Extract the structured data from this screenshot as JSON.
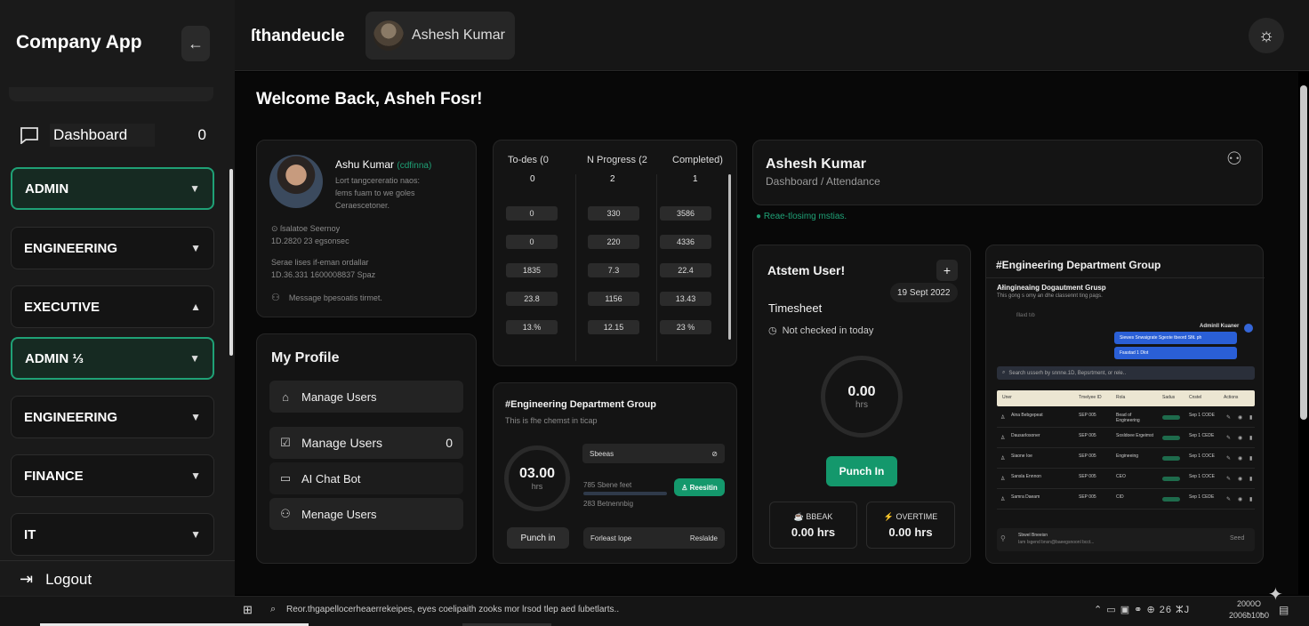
{
  "sidebar": {
    "brand": "Company App",
    "collapse_icon": "←",
    "dashboard": {
      "label": "Dashboard",
      "count": "0"
    },
    "groups": [
      {
        "label": "ADMIN",
        "chevron": "⌄",
        "active": true
      },
      {
        "label": "ENGINEERING",
        "chevron": "⌄",
        "active": false
      },
      {
        "label": "EXECUTIVE",
        "chevron": "⌃",
        "active": false
      },
      {
        "label": "ADMIN ⅓",
        "chevron": "⌄",
        "active": true
      },
      {
        "label": "ENGINEERING",
        "chevron": "⌄",
        "active": false
      },
      {
        "label": "FINANCE",
        "chevron": "⌄",
        "active": false
      },
      {
        "label": "IT",
        "chevron": "⌄",
        "active": false
      }
    ],
    "logout": "Logout"
  },
  "header": {
    "title": "ſthandeucle",
    "user_name": "Ashesh Kumar",
    "theme_icon": "☼"
  },
  "main": {
    "welcome": "Welcome Back, Asheh Fosr!",
    "profile_card": {
      "name": "Ashu Kumar",
      "name_tag": "(cdfinna)",
      "lines": [
        "Ŀort tangcereratio naos:",
        "ſems fuam to we goles",
        "Ceraescetoner."
      ],
      "meta1": [
        "⊙ ſsalatoe Seernoy",
        "1D.2820 23 egsonsec"
      ],
      "meta2": [
        "Serae lises if-eman ordallar",
        "1D.36.331 1600008837 Spaz"
      ],
      "message": "Message bpesoatis tirmet."
    },
    "tasks": {
      "headers": [
        "To-des (0",
        "N Progress (2",
        "Completed)"
      ],
      "totals": [
        "0",
        "2",
        "1"
      ],
      "rows": [
        [
          "0",
          "330",
          "3586"
        ],
        [
          "0",
          "220",
          "4336"
        ],
        [
          "1835",
          "7.3",
          "22.4"
        ],
        [
          "23.8",
          "1156",
          "13.43"
        ],
        [
          "13.%",
          "12.15",
          "23 %"
        ]
      ]
    },
    "my_profile": {
      "title": "My Profile",
      "items": [
        {
          "label": "Manage Users",
          "icon": "home-icon",
          "count": ""
        },
        {
          "label": "Manage Users",
          "icon": "check-square-icon",
          "count": "0"
        },
        {
          "label": "AI Chat Bot",
          "icon": "chat-icon",
          "count": ""
        },
        {
          "label": "Menage Users",
          "icon": "users-icon",
          "count": ""
        }
      ]
    },
    "eng_group": {
      "title": "#Engineering Department Group",
      "subtitle": "This is fhe chemst in ticap",
      "ring_value": "03.00",
      "ring_unit": "hrs",
      "status_label": "Sbeeas",
      "status_icon": "⊘",
      "line1": "785 Sbene feet",
      "line2": "283 Betnennbig",
      "green_btn": "♙ Reesitin",
      "punch_btn": "Punch in",
      "bottom_left": "Forleast lope",
      "bottom_right": "Reslalde"
    },
    "user_header": {
      "name": "Ashesh Kumar",
      "breadcrumb": "Dashboard / Attendance",
      "status": "Reae-tlosimg mstias."
    },
    "timesheet": {
      "title": "Atstem User!",
      "plus": "+",
      "date": "19 Sept 2022",
      "section": "Timesheet",
      "status": "Not checked in today",
      "hours": "0.00",
      "hours_unit": "hrs",
      "punch": "Punch In",
      "break_label": "BBEAK",
      "break_value": "0.00 hrs",
      "overtime_label": "OVERTIME",
      "overtime_value": "0.00 hrs"
    },
    "chat": {
      "title": "#Engineering Department Group",
      "sub_title": "Ałingineaing Dogautment Grusp",
      "sub_desc": "This gong s omy an dhe classennt ting pags.",
      "meta": "ſllaıd tıb",
      "sender": "Adminll Kuaner",
      "bubble1": "Siewes Snwaigrate   Sgeote tbeord SfiŁ ph",
      "bubble2": "Fsastad 1 Dlot",
      "search": "Search usserh by snnne.1D, Bepsrtment, or rele..",
      "columns": [
        "Uner",
        "Tmelyee ID",
        "Rola",
        "Sadus",
        "Cnstel",
        "Actions"
      ],
      "rows": [
        [
          "Aina Bebgepeat",
          "SEP 005",
          "Bead of Engineering",
          "",
          "Sep 1 CODE"
        ],
        [
          "Dausarlosoner",
          "SEP 005",
          "Sosldoee Ergeimst",
          "",
          "Sep 1 CEDE"
        ],
        [
          "Siaone Ioe",
          "SEP 005",
          "Engineeing",
          "",
          "Sep 1 COCE"
        ],
        [
          "Sansla Ennnon",
          "SEP 005",
          "CEO",
          "",
          "Sep 1 COCE"
        ],
        [
          "Samra Daeam",
          "SEP 005",
          "CID",
          "",
          "Sep 1 CEDE"
        ]
      ],
      "footer_name": "Sbwel Bneeisn",
      "footer_text": "Iam Isgend bnsn@baeegsnoonl bcct...",
      "send": "Seed"
    }
  },
  "taskbar": {
    "search_text": "Reor.thgapellocerheaerrekeipes, eyes coelipaith zooks mor lrsod tlep aed ſubetlarts..",
    "time": "2000O",
    "date": "2006ƀ10ƀ0",
    "tray": "⌃  ▭  ▣  ⚭  ⊕ 26  ⵣJ"
  }
}
